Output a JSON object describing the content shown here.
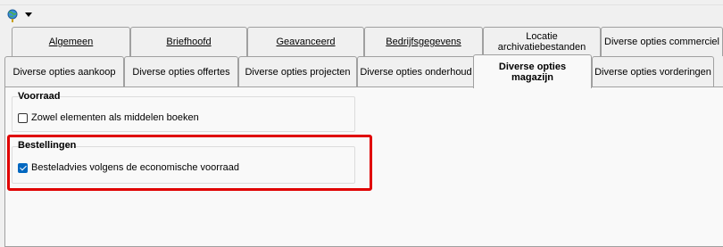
{
  "toolbar": {
    "icon": "globe-pin-icon"
  },
  "tabs_row1": [
    {
      "label": "Algemeen"
    },
    {
      "label": "Briefhoofd"
    },
    {
      "label": "Geavanceerd"
    },
    {
      "label": "Bedrijfsgegevens"
    },
    {
      "label_line1": "Locatie",
      "label_line2": "archivatiebestanden"
    },
    {
      "label": "Diverse opties commerciel"
    }
  ],
  "tabs_row2": [
    {
      "label": "Diverse opties aankoop"
    },
    {
      "label": "Diverse opties offertes"
    },
    {
      "label": "Diverse opties projecten"
    },
    {
      "label": "Diverse opties onderhoud"
    },
    {
      "label_line1": "Diverse opties",
      "label_line2": "magazijn",
      "active": true
    },
    {
      "label": "Diverse opties vorderingen"
    }
  ],
  "voorraad": {
    "title": "Voorraad",
    "option": {
      "label": "Zowel elementen als middelen boeken",
      "checked": false
    }
  },
  "bestellingen": {
    "title": "Bestellingen",
    "option": {
      "label": "Besteladvies volgens de economische voorraad",
      "checked": true
    }
  },
  "colors": {
    "highlight": "#e00000",
    "checkbox_checked": "#0067c0"
  }
}
